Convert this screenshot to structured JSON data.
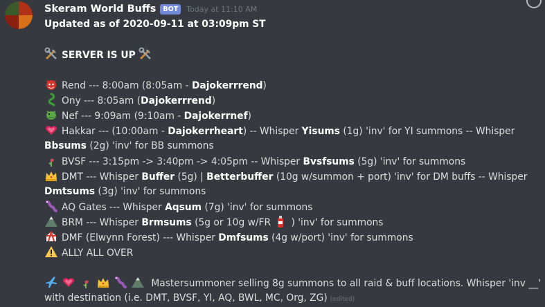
{
  "message": {
    "username": "Skeram World Buffs",
    "bot_tag": "BOT",
    "timestamp": "Today at 11:10 AM",
    "updated": "Updated as of 2020-09-11 at 03:09pm ST",
    "server_status": "SERVER IS UP",
    "lines": [
      {
        "icon": "demon-face-icon",
        "segs": [
          {
            "t": "Rend --- 8:00am (8:05am - "
          },
          {
            "t": "Dajokerrrend",
            "b": true
          },
          {
            "t": ")"
          }
        ]
      },
      {
        "icon": "dragon-icon",
        "segs": [
          {
            "t": "Ony --- 8:05am ("
          },
          {
            "t": "Dajokerrrend",
            "b": true
          },
          {
            "t": ")"
          }
        ]
      },
      {
        "icon": "dragon-face-icon",
        "segs": [
          {
            "t": "Nef --- 9:09am (9:10am - "
          },
          {
            "t": "Dajokerrnef",
            "b": true
          },
          {
            "t": ")"
          }
        ]
      },
      {
        "icon": "heart-icon",
        "segs": [
          {
            "t": "Hakkar  ---  (10:00am - "
          },
          {
            "t": "Dajokerrheart",
            "b": true
          },
          {
            "t": ")  --  Whisper  "
          },
          {
            "t": "Yisums",
            "b": true
          },
          {
            "t": " (1g)  'inv' for YI summons  --  Whisper"
          }
        ]
      },
      {
        "icon": "",
        "segs": [
          {
            "t": "Bbsums",
            "b": true
          },
          {
            "t": " (2g)  'inv' for BB summons"
          }
        ]
      },
      {
        "icon": "wilted-flower-icon",
        "segs": [
          {
            "t": "BVSF --- 3:15pm -> 3:40pm -> 4:05pm  --  Whisper  "
          },
          {
            "t": "Bvsfsums",
            "b": true
          },
          {
            "t": " (5g)  'inv' for summons"
          }
        ]
      },
      {
        "icon": "crown-icon",
        "segs": [
          {
            "t": "DMT --- Whisper  "
          },
          {
            "t": "Buffer",
            "b": true
          },
          {
            "t": " (5g)   |   "
          },
          {
            "t": "Betterbuffer",
            "b": true
          },
          {
            "t": " (10g w/summon + port)  'inv' for DM buffs  --  Whisper"
          }
        ]
      },
      {
        "icon": "",
        "segs": [
          {
            "t": " "
          },
          {
            "t": "Dmtsums",
            "b": true
          },
          {
            "t": " (3g)  'inv' for summons"
          }
        ]
      },
      {
        "icon": "worm-icon",
        "segs": [
          {
            "t": "AQ Gates --- Whisper  "
          },
          {
            "t": "Aqsum",
            "b": true
          },
          {
            "t": " (7g)  'inv' for summons"
          }
        ]
      },
      {
        "icon": "mountain-icon",
        "segs": [
          {
            "t": "BRM --- Whisper  "
          },
          {
            "t": "Brmsums",
            "b": true
          },
          {
            "t": " (5g or 10g w/FR "
          },
          {
            "t": "",
            "icon": "fire-extinguisher-icon"
          },
          {
            "t": ")  'inv' for summons"
          }
        ]
      },
      {
        "icon": "circus-tent-icon",
        "segs": [
          {
            "t": "DMF (Elwynn Forest) --- Whisper  "
          },
          {
            "t": "Dmfsums",
            "b": true
          },
          {
            "t": " (4g w/port)  'inv' for summons"
          }
        ]
      },
      {
        "icon": "warning-icon",
        "segs": [
          {
            "t": "ALLY ALL OVER"
          }
        ]
      }
    ],
    "footer_icons": [
      "airplane-icon",
      "heart-icon",
      "wilted-flower-icon",
      "crown-icon",
      "worm-icon",
      "mountain-icon"
    ],
    "footer_text_1": "Mastersummoner selling 8g summons to all raid & buff locations. Whisper 'inv __'",
    "footer_text_2": "with destination (i.e. DMT, BVSF, YI, AQ, BWL, MC, Org, ZG)",
    "edited": "(edited)"
  },
  "colors": {
    "background": "#36393f",
    "text": "#dcddde",
    "username": "#ffffff",
    "bot_tag": "#7289da",
    "muted": "#72767d"
  }
}
